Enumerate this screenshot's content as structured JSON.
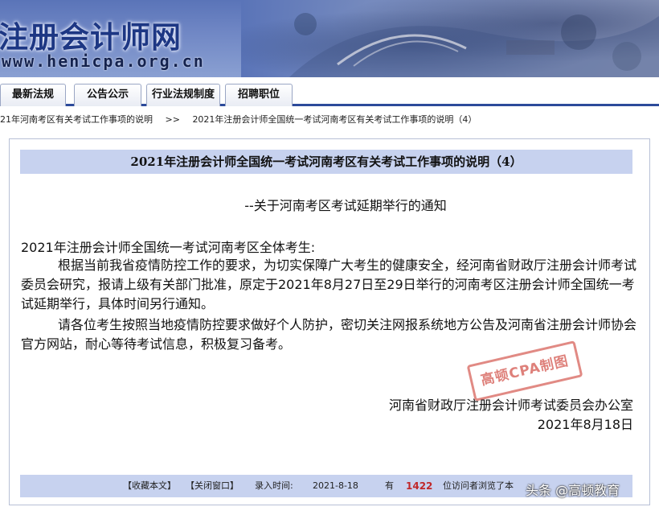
{
  "site": {
    "title": "注册会计师网",
    "url": "www.henicpa.org.cn"
  },
  "nav": {
    "tabs": [
      {
        "label": "最新法规"
      },
      {
        "label": "公告公示"
      },
      {
        "label": "行业法规制度"
      },
      {
        "label": "招聘职位"
      }
    ]
  },
  "breadcrumb": {
    "parent": "21年河南考区有关考试工作事项的说明",
    "separator": ">>",
    "current": "2021年注册会计师全国统一考试河南考区有关考试工作事项的说明（4）"
  },
  "article": {
    "title": "2021年注册会计师全国统一考试河南考区有关考试工作事项的说明（4）",
    "subtitle": "--关于河南考区考试延期举行的通知",
    "salutation": "2021年注册会计师全国统一考试河南考区全体考生:",
    "paragraphs": [
      "根据当前我省疫情防控工作的要求，为切实保障广大考生的健康安全，经河南省财政厅注册会计师考试委员会研究，报请上级有关部门批准，原定于2021年8月27日至29日举行的河南考区注册会计师全国统一考试延期举行，具体时间另行通知。",
      "请各位考生按照当地疫情防控要求做好个人防护，密切关注网报系统地方公告及河南省注册会计师协会官方网站，耐心等待考试信息，积极复习备考。"
    ],
    "signer": "河南省财政厅注册会计师考试委员会办公室",
    "date": "2021年8月18日"
  },
  "stamp": {
    "text": "高顿CPA制图"
  },
  "footer": {
    "bookmark": "【收藏本文】",
    "close": "【关闭窗口】",
    "entry_label": "录入时间:",
    "entry_date": "2021-8-18",
    "have": "有",
    "visitor_count": "1422",
    "viewed_text": "位访问者浏览了本"
  },
  "watermark": {
    "text": "头条 @高顿教育"
  }
}
